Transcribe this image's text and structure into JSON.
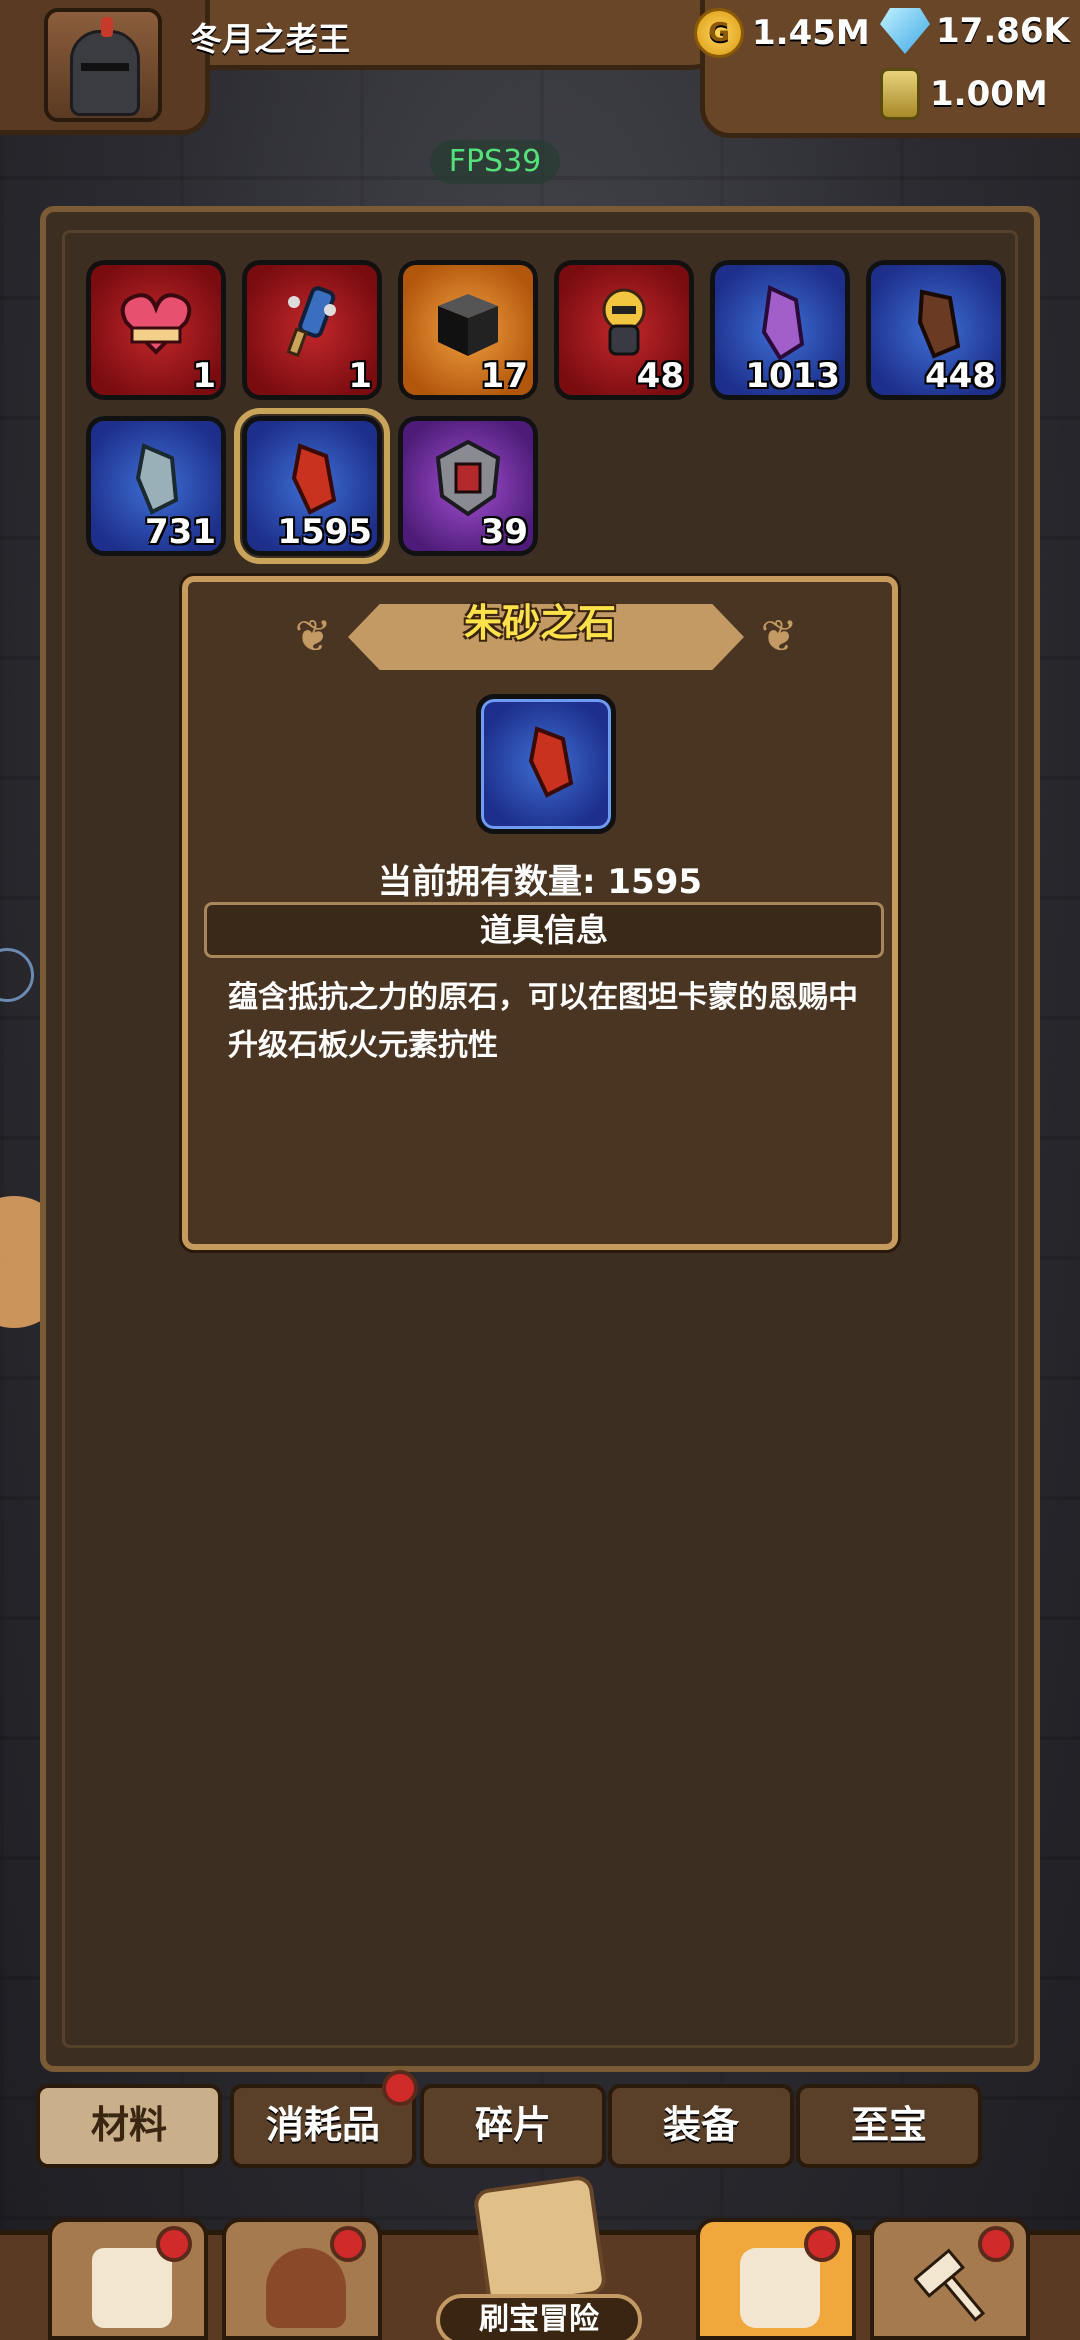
{
  "player": {
    "name": "冬月之老王"
  },
  "resources": {
    "gold": "1.45M",
    "gems": "17.86K",
    "potion": "1.00M"
  },
  "fps": "FPS39",
  "inventory": [
    {
      "count": "1",
      "rarity": "red",
      "icon": "heart-chest-icon"
    },
    {
      "count": "1",
      "rarity": "red",
      "icon": "spiked-club-icon"
    },
    {
      "count": "17",
      "rarity": "orange",
      "icon": "black-box-icon"
    },
    {
      "count": "48",
      "rarity": "red",
      "icon": "hero-figure-icon"
    },
    {
      "count": "1013",
      "rarity": "blue",
      "icon": "purple-stone-icon"
    },
    {
      "count": "448",
      "rarity": "blue",
      "icon": "brown-stone-icon"
    },
    {
      "count": "731",
      "rarity": "blue",
      "icon": "grey-stone-icon"
    },
    {
      "count": "1595",
      "rarity": "blue",
      "icon": "red-stone-icon",
      "selected": true
    },
    {
      "count": "39",
      "rarity": "purple",
      "icon": "shield-emblem-icon"
    }
  ],
  "detail": {
    "title": "朱砂之石",
    "owned": "当前拥有数量: 1595",
    "info_header": "道具信息",
    "description": "蕴含抵抗之力的原石，可以在图坦卡蒙的恩赐中升级石板火元素抗性"
  },
  "tabs": [
    {
      "label": "材料",
      "active": true
    },
    {
      "label": "消耗品",
      "badge": true
    },
    {
      "label": "碎片"
    },
    {
      "label": "装备"
    },
    {
      "label": "至宝"
    }
  ],
  "bottom_nav": {
    "center_label": "刷宝冒险"
  },
  "colors": {
    "panel": "#3c2e20",
    "panel_border": "#7b5a36",
    "title_yellow": "#ffe24a",
    "badge_red": "#d12a2a",
    "fps_green": "#54e07a"
  }
}
